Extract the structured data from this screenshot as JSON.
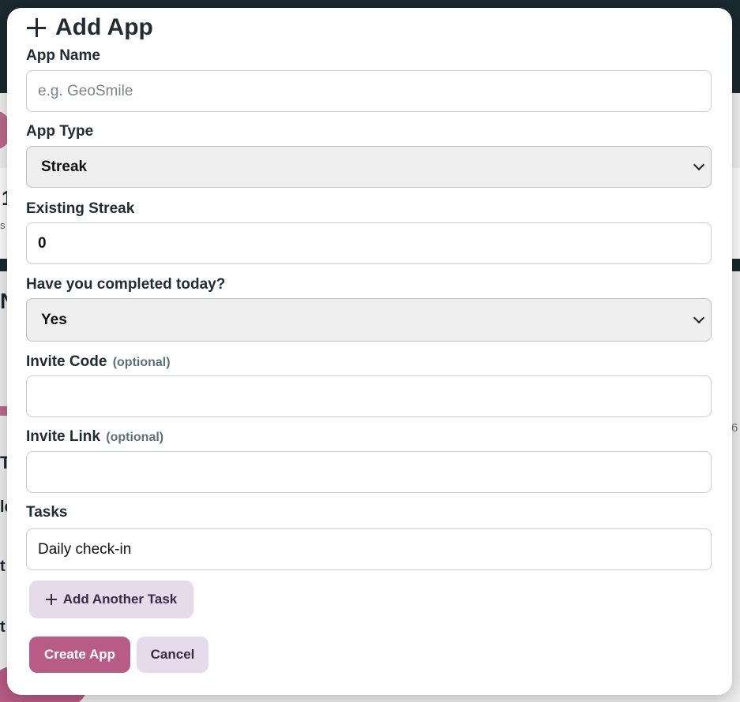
{
  "modal": {
    "title": "Add App",
    "app_name": {
      "label": "App Name",
      "placeholder": "e.g. GeoSmile",
      "value": ""
    },
    "app_type": {
      "label": "App Type",
      "selected": "Streak"
    },
    "existing_streak": {
      "label": "Existing Streak",
      "value": "0"
    },
    "completed_today": {
      "label": "Have you completed today?",
      "selected": "Yes"
    },
    "invite_code": {
      "label": "Invite Code",
      "optional": "(optional)",
      "value": ""
    },
    "invite_link": {
      "label": "Invite Link",
      "optional": "(optional)",
      "value": ""
    },
    "tasks": {
      "label": "Tasks",
      "items": [
        "Daily check-in"
      ]
    },
    "add_task_label": "Add Another Task",
    "create_label": "Create App",
    "cancel_label": "Cancel"
  },
  "colors": {
    "accent": "#b85c87",
    "secondary_button": "#e6dbea",
    "text": "#1f2d33",
    "backdrop_dark": "#1b2a30"
  }
}
